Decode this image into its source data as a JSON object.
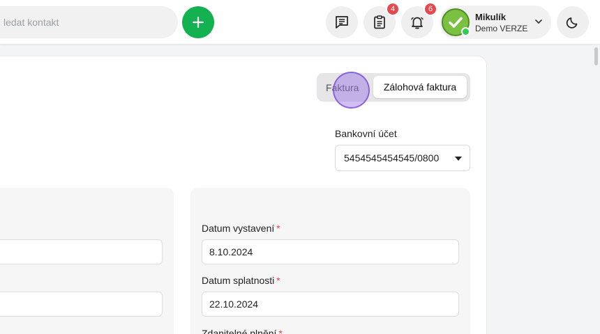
{
  "header": {
    "search_placeholder": "ledat kontakt",
    "add_icon": "plus-icon",
    "notes_icon": "message-lines-icon",
    "tasks_icon": "clipboard-icon",
    "tasks_count": "4",
    "notifications_icon": "bell-icon",
    "notifications_count": "6",
    "user": {
      "name": "Mikulík",
      "subtitle": "Demo VERZE",
      "avatar_icon": "check-icon"
    },
    "theme_icon": "moon-icon"
  },
  "form": {
    "invoice_type": {
      "options": [
        "Faktura",
        "Zálohová faktura"
      ],
      "selected": "Zálohová faktura"
    },
    "bank_account": {
      "label": "Bankovní účet",
      "value": "5454545454545/0800"
    },
    "issue_date": {
      "label": "Datum vystavení",
      "required": "*",
      "value": "8.10.2024"
    },
    "due_date": {
      "label": "Datum splatnosti",
      "required": "*",
      "value": "22.10.2024"
    },
    "taxable_date": {
      "label": "Zdanitelné plnění",
      "required": "*"
    }
  },
  "colors": {
    "accent_green": "#13b14f",
    "badge_red": "#e5484d",
    "click_marker": "#9a6ee6"
  }
}
